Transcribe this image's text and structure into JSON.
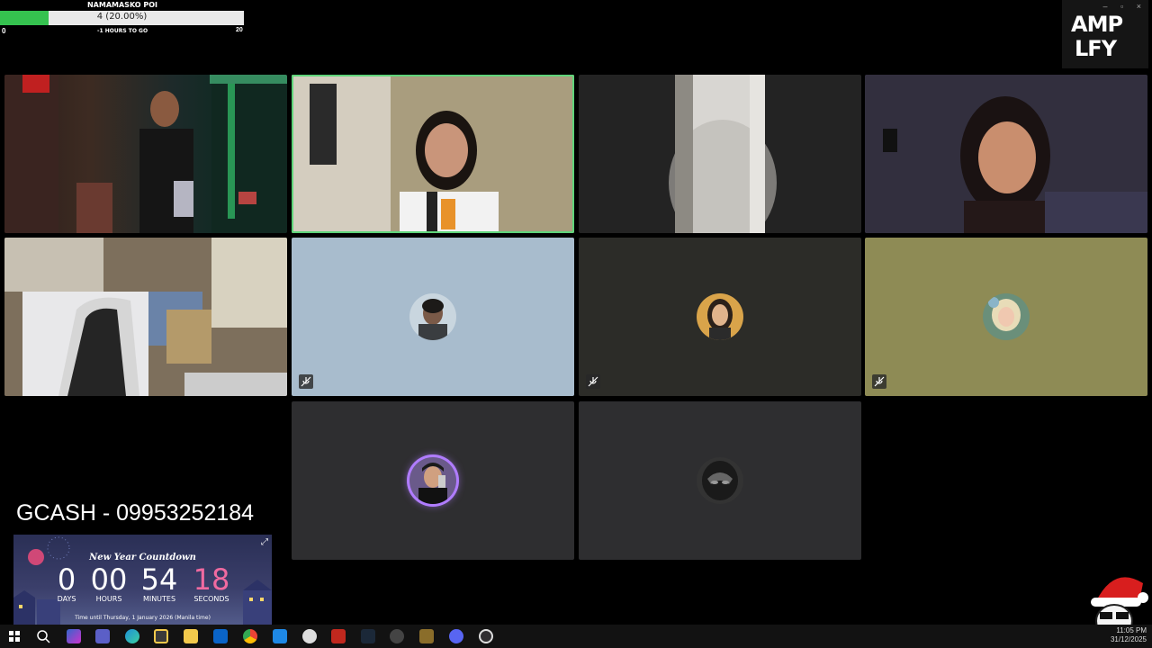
{
  "goal": {
    "title": "NAMAMASKO POI",
    "progress_text": "4 (20.00%)",
    "progress_fraction": 0.2,
    "min": "0",
    "subtitle": "-1 HOURS TO GO",
    "max": "20"
  },
  "logo": {
    "line1": "AMP",
    "line2": "LFY"
  },
  "gcash": "GCASH - 09953252184",
  "countdown": {
    "title": "New Year Countdown",
    "units": [
      {
        "value": "0",
        "label": "DAYS"
      },
      {
        "value": "00",
        "label": "HOURS"
      },
      {
        "value": "54",
        "label": "MINUTES"
      },
      {
        "value": "18",
        "label": "SECONDS"
      }
    ],
    "footer": "Time until Thursday, 1 January 2026 (Manila time)"
  },
  "clock": {
    "time": "11:05 PM",
    "date": "31/12/2025"
  },
  "colors": {
    "goal_fill": "#35c24f",
    "active_border": "#5fd47a",
    "tile_blue": "#a8bccd",
    "tile_olive": "#8e8b55",
    "tile_dark": "#2c2c28",
    "tile_gray": "#2e2e30",
    "seconds": "#f06aa0"
  },
  "taskbar_icons": [
    "windows-start-icon",
    "search-icon",
    "copilot-icon",
    "teams-icon",
    "edge-icon",
    "file-explorer-icon",
    "store-icon",
    "mail-icon",
    "chrome-icon",
    "app-icon",
    "feather-icon",
    "video-app-icon",
    "steam-icon",
    "audio-icon",
    "winrar-icon",
    "discord-icon",
    "obs-icon"
  ]
}
